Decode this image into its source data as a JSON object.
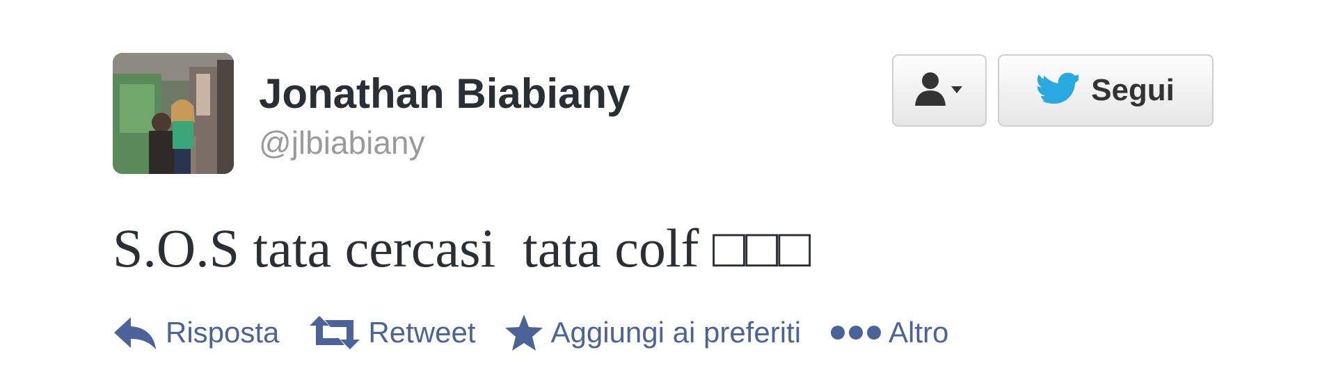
{
  "author": {
    "name": "Jonathan Biabiany",
    "handle": "@jlbiabiany"
  },
  "buttons": {
    "user_menu_icon": "user-dropdown-icon",
    "follow_label": "Segui",
    "follow_icon": "twitter-bird-icon"
  },
  "tweet": {
    "text": "S.O.S tata cercasi  tata colf □□□"
  },
  "actions": {
    "reply": {
      "label": "Risposta",
      "icon": "reply-icon"
    },
    "retweet": {
      "label": "Retweet",
      "icon": "retweet-icon"
    },
    "favorite": {
      "label": "Aggiungi ai preferiti",
      "icon": "star-icon"
    },
    "more": {
      "label": "Altro",
      "icon": "more-dots-icon"
    }
  },
  "colors": {
    "action": "#4b6398",
    "bird": "#2aa9e0",
    "name": "#292f33",
    "handle": "#9a9a9a"
  }
}
